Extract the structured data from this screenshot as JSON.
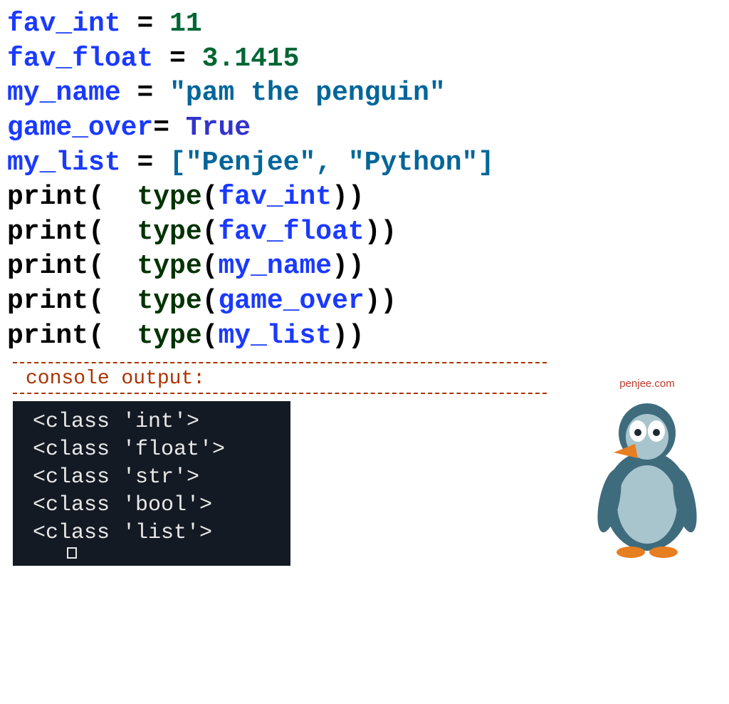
{
  "code": {
    "l1": {
      "var": "fav_int",
      "assign": " = ",
      "val": "11"
    },
    "l2": {
      "var": "fav_float",
      "assign": " = ",
      "val": "3.1415"
    },
    "l3": {
      "var": "my_name",
      "assign": " = ",
      "val": "\"pam the penguin\""
    },
    "l4": {
      "var": "game_over",
      "assign": "= ",
      "val": "True"
    },
    "l5": {
      "var": "my_list",
      "assign": " = ",
      "lb": "[",
      "s1": "\"Penjee\"",
      "comma": ", ",
      "s2": "\"Python\"",
      "rb": "]"
    },
    "l6": {
      "func": "print",
      "lp": "(",
      "sp1": "  ",
      "type": "type",
      "lp2": "(",
      "arg": "fav_int",
      "rp2": ")",
      "rp": ")"
    },
    "l7": {
      "func": "print",
      "lp": "(",
      "sp1": "  ",
      "type": "type",
      "lp2": "(",
      "arg": "fav_float",
      "rp2": ")",
      "rp": ")"
    },
    "l8": {
      "func": "print",
      "lp": "(",
      "sp1": "  ",
      "type": "type",
      "lp2": "(",
      "arg": "my_name",
      "rp2": ")",
      "rp": ")"
    },
    "l9": {
      "func": "print",
      "lp": "(",
      "sp1": "  ",
      "type": "type",
      "lp2": "(",
      "arg": "game_over",
      "rp2": ")",
      "rp": ")"
    },
    "l10": {
      "func": "print",
      "lp": "(",
      "sp1": "  ",
      "type": "type",
      "lp2": "(",
      "arg": "my_list",
      "rp2": ")",
      "rp": ")"
    }
  },
  "console_label": "console output:",
  "console_output": {
    "l1": "<class 'int'>",
    "l2": "<class 'float'>",
    "l3": "<class 'str'>",
    "l4": "<class 'bool'>",
    "l5": "<class 'list'>"
  },
  "site_tag": "penjee.com"
}
